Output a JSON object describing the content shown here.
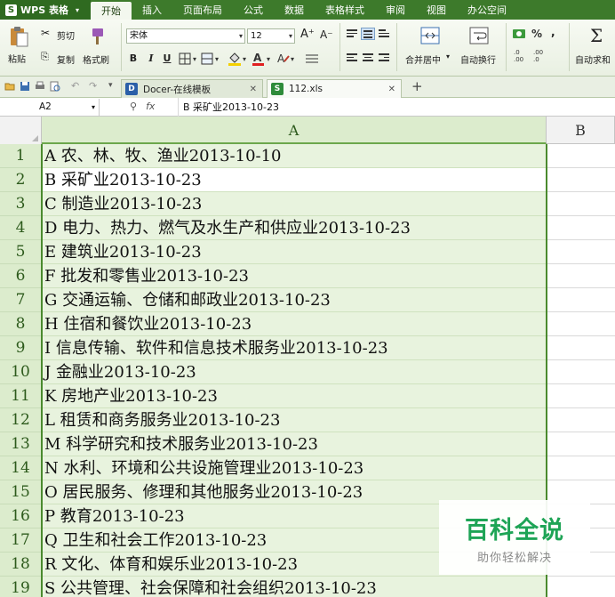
{
  "app": {
    "logo_label": "WPS 表格",
    "logo_letter": "S"
  },
  "menu_tabs": [
    "开始",
    "插入",
    "页面布局",
    "公式",
    "数据",
    "表格样式",
    "审阅",
    "视图",
    "办公空间"
  ],
  "ribbon": {
    "cut_label": "剪切",
    "paste_label": "粘贴",
    "copy_label": "复制",
    "format_painter_label": "格式刷",
    "font_name": "宋体",
    "font_size": "12",
    "bold": "B",
    "italic": "I",
    "underline": "U",
    "grow_font": "A⁺",
    "shrink_font": "A⁻",
    "merge_center_label": "合并居中",
    "wrap_text_label": "自动换行",
    "percent_label": "%",
    "autosum_label": "自动求和",
    "decimal_inc": ".0 .00",
    "decimal_dec": ".00 .0"
  },
  "doc_tabs": [
    {
      "label": "Docer-在线模板",
      "icon": "docer-icon"
    },
    {
      "label": "112.xls",
      "icon": "xls-icon"
    }
  ],
  "formula_bar": {
    "cell_ref": "A2",
    "fx_symbol": "fx",
    "content": "B 采矿业2013-10-23"
  },
  "grid": {
    "columns": [
      "A",
      "B"
    ],
    "selected_column": "A",
    "active_row": 2,
    "rows": [
      {
        "num": "1",
        "a": "A 农、林、牧、渔业2013-10-10"
      },
      {
        "num": "2",
        "a": "B 采矿业2013-10-23"
      },
      {
        "num": "3",
        "a": "C 制造业2013-10-23"
      },
      {
        "num": "4",
        "a": "D 电力、热力、燃气及水生产和供应业2013-10-23"
      },
      {
        "num": "5",
        "a": "E 建筑业2013-10-23"
      },
      {
        "num": "6",
        "a": "F 批发和零售业2013-10-23"
      },
      {
        "num": "7",
        "a": "G 交通运输、仓储和邮政业2013-10-23"
      },
      {
        "num": "8",
        "a": "H 住宿和餐饮业2013-10-23"
      },
      {
        "num": "9",
        "a": "I 信息传输、软件和信息技术服务业2013-10-23"
      },
      {
        "num": "10",
        "a": "J 金融业2013-10-23"
      },
      {
        "num": "11",
        "a": "K 房地产业2013-10-23"
      },
      {
        "num": "12",
        "a": "L 租赁和商务服务业2013-10-23"
      },
      {
        "num": "13",
        "a": "M 科学研究和技术服务业2013-10-23"
      },
      {
        "num": "14",
        "a": "N 水利、环境和公共设施管理业2013-10-23"
      },
      {
        "num": "15",
        "a": "O 居民服务、修理和其他服务业2013-10-23"
      },
      {
        "num": "16",
        "a": "P 教育2013-10-23"
      },
      {
        "num": "17",
        "a": "Q 卫生和社会工作2013-10-23"
      },
      {
        "num": "18",
        "a": "R 文化、体育和娱乐业2013-10-23"
      },
      {
        "num": "19",
        "a": "S 公共管理、社会保障和社会组织2013-10-23"
      }
    ]
  },
  "watermark": {
    "title": "百科全说",
    "subtitle": "助你轻松解决"
  },
  "colors": {
    "menubar": "#3d7a2b",
    "selection_fill": "#e8f3de",
    "selection_border": "#4a8a2e",
    "watermark_green": "#1ea456"
  }
}
